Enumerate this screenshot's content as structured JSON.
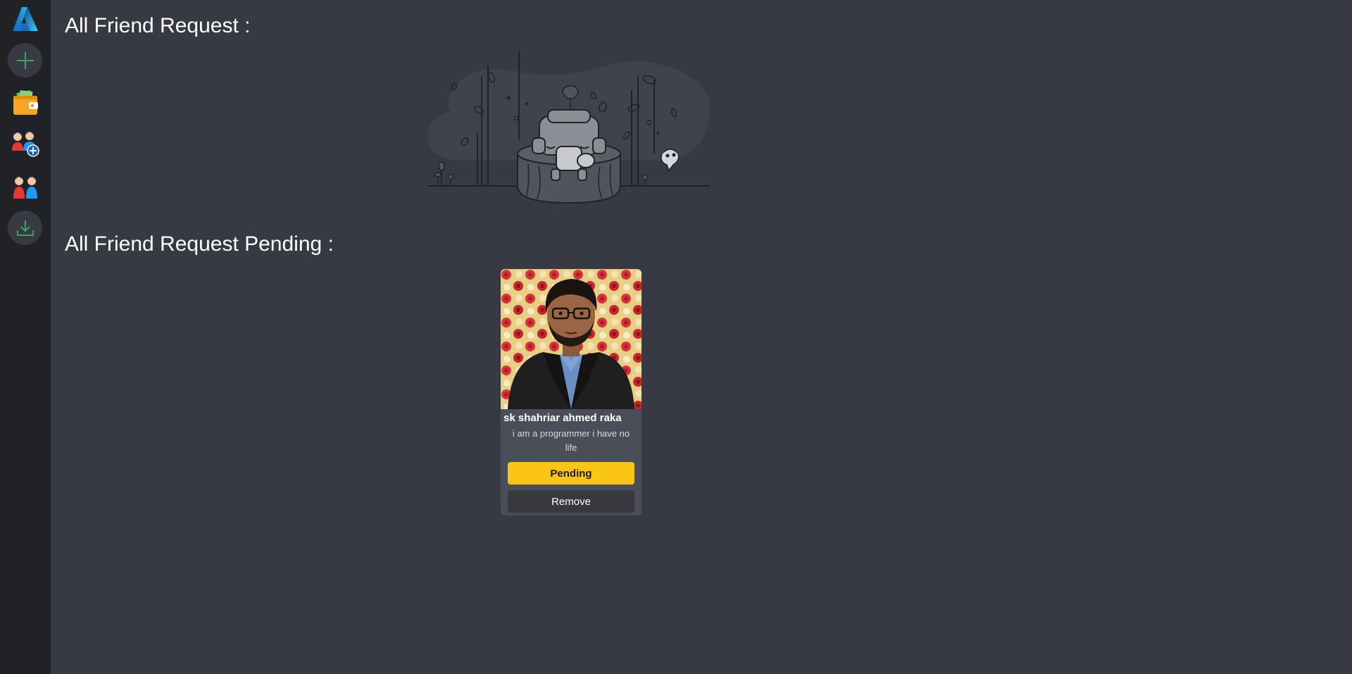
{
  "sidebar": {
    "items": [
      {
        "icon": "app-logo-icon"
      },
      {
        "icon": "plus-icon"
      },
      {
        "icon": "wallet-icon"
      },
      {
        "icon": "add-friend-icon"
      },
      {
        "icon": "friends-icon"
      },
      {
        "icon": "download-icon"
      }
    ],
    "accent": "#3ba55c"
  },
  "main": {
    "requests_heading": "All Friend Request :",
    "pending_heading": "All Friend Request Pending :",
    "pending": [
      {
        "name": "sk shahriar ahmed raka",
        "bio": "i am a programmer i have no life",
        "pending_label": "Pending",
        "remove_label": "Remove"
      }
    ]
  },
  "colors": {
    "background": "#373a42",
    "sidebar": "#202226",
    "pending_button": "#fac515",
    "remove_button": "#37393e",
    "card": "#4a4e58"
  }
}
